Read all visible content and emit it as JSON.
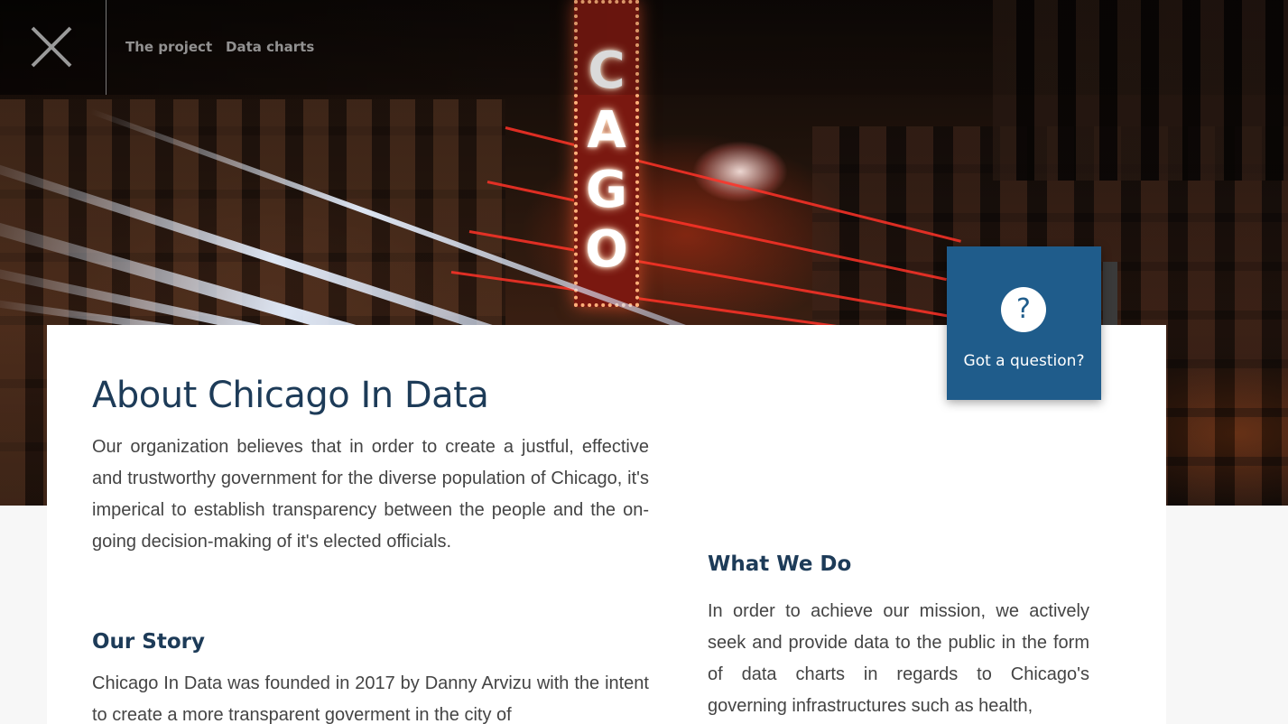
{
  "nav": {
    "close_icon": "close-x-icon",
    "links": [
      "The project",
      "Data charts"
    ]
  },
  "hero": {
    "sign_letters": [
      "C",
      "A",
      "G",
      "O"
    ]
  },
  "help": {
    "icon": "?",
    "label": "Got a question?"
  },
  "about": {
    "title": "About Chicago In Data",
    "intro": "Our organization believes that in order to create a justful, effective and trustworthy government for the diverse population of Chicago, it's imperical to establish transparency between the people and the on-going decision-making of it's elected officials."
  },
  "story": {
    "heading": "Our Story",
    "text": "Chicago In Data was founded in 2017 by Danny Arvizu with the intent to create a more transparent goverment in the city of"
  },
  "what_we_do": {
    "heading": "What We Do",
    "text": "In order to achieve our mission, we actively seek and provide data to the public in the form of data charts in regards to Chicago's governing infrastructures such as health,"
  },
  "colors": {
    "brand_blue": "#1f5c8b",
    "heading_navy": "#1d3b58",
    "body_text": "#444444"
  }
}
